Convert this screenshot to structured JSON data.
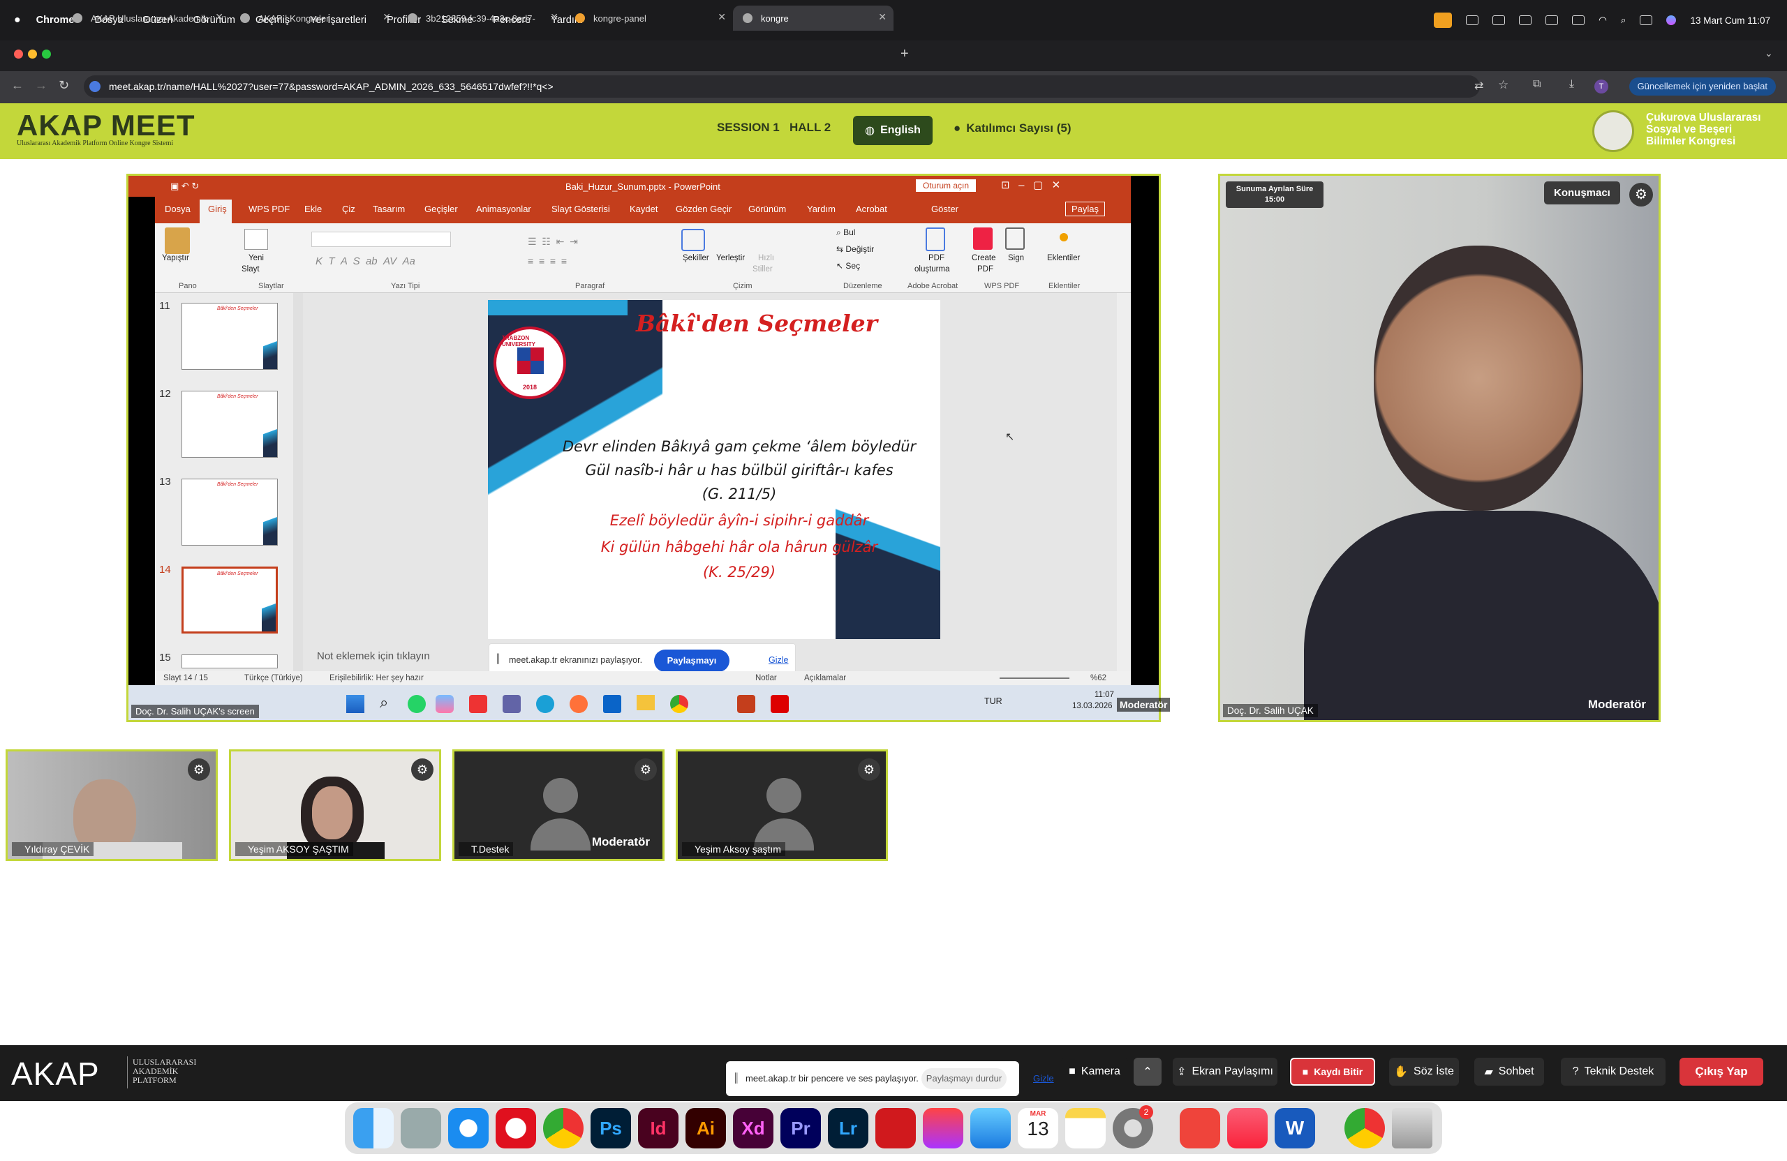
{
  "menubar": {
    "items": [
      "Chrome",
      "Dosya",
      "Düzen",
      "Görünüm",
      "Geçmiş",
      "Yer İşaretleri",
      "Profiller",
      "Sekme",
      "Pencere",
      "Yardım"
    ],
    "clock": "13 Mart Cum  11:07"
  },
  "tabs": [
    {
      "label": "AKAP Uluslararası Akademik"
    },
    {
      "label": "AKAP | Kongreler"
    },
    {
      "label": "3b212859-fc39-4a3c-8ed7-"
    },
    {
      "label": "kongre-panel"
    },
    {
      "label": "kongre"
    }
  ],
  "address": {
    "url": "meet.akap.tr/name/HALL%2027?user=77&password=AKAP_ADMIN_2026_633_5646517dwfef?!!*q<>",
    "restart_label": "Güncellemek için yeniden başlat",
    "profile_initial": "T"
  },
  "header": {
    "logo": "AKAP MEET",
    "logo_sub": "Uluslararası Akademik Platform Online Kongre Sistemi",
    "session": "SESSION 1",
    "hall": "HALL 2",
    "language": "English",
    "participants": "Katılımcı Sayısı (5)",
    "congress_l1": "Çukurova Uluslararası",
    "congress_l2": "Sosyal ve Beşeri",
    "congress_l3": "Bilimler Kongresi"
  },
  "powerpoint": {
    "title": "Baki_Huzur_Sunum.pptx  -  PowerPoint",
    "signin": "Oturum açın",
    "tabs": [
      "Dosya",
      "Giriş",
      "WPS PDF",
      "Ekle",
      "Çiz",
      "Tasarım",
      "Geçişler",
      "Animasyonlar",
      "Slayt Gösterisi",
      "Kaydet",
      "Gözden Geçir",
      "Görünüm",
      "Yardım",
      "Acrobat",
      "Göster"
    ],
    "share": "Paylaş",
    "groups": [
      "Pano",
      "Slaytlar",
      "Yazı Tipi",
      "Paragraf",
      "Çizim",
      "Düzenleme",
      "Adobe Acrobat",
      "WPS PDF",
      "Eklentiler"
    ],
    "buttons": {
      "paste": "Yapıştır",
      "new_slide_1": "Yeni",
      "new_slide_2": "Slayt",
      "shapes": "Şekiller",
      "arrange": "Yerleştir",
      "quick": "Hızlı",
      "styles": "Stiller",
      "find": "Bul",
      "replace": "Değiştir",
      "select": "Seç",
      "pdf1": "PDF",
      "pdf2": "oluşturma",
      "create1": "Create",
      "create2": "PDF",
      "sign": "Sign",
      "addins": "Eklentiler"
    },
    "thumb_numbers": [
      "11",
      "12",
      "13",
      "14",
      "15"
    ],
    "thumb_title": "Bâkî'den Seçmeler",
    "notes_placeholder": "Not eklemek için tıklayın",
    "status_slide": "Slayt 14 / 15",
    "status_lang": "Türkçe (Türkiye)",
    "status_access": "Erişilebilirlik: Her şey hazır",
    "status_notes": "Notlar",
    "status_comments": "Açıklamalar",
    "zoom": "%62",
    "share_notice": "meet.akap.tr ekranınızı paylaşıyor.",
    "stop_share": "Paylaşmayı durdur",
    "hide": "Gizle"
  },
  "slide": {
    "title": "Bâkî'den Seçmeler",
    "badge_text": "TRABZON UNIVERSITY",
    "badge_year": "2018",
    "lines": [
      {
        "text": "Devr elinden Bâkıyâ gam çekme ‘âlem böyledür",
        "color": "#1a1a1a"
      },
      {
        "text": "Gül nasîb-i hâr u has bülbül giriftâr-ı kafes",
        "color": "#1a1a1a"
      },
      {
        "text": "(G. 211/5)",
        "color": "#1a1a1a"
      },
      {
        "text": "Ezelî böyledür âyîn-i sipihr-i gaddâr",
        "color": "#d42020"
      },
      {
        "text": "Ki gülün hâbgehi hâr ola hârun gülzâr",
        "color": "#d42020"
      },
      {
        "text": "(K. 25/29)",
        "color": "#d42020"
      }
    ]
  },
  "windows_taskbar": {
    "lang": "TUR",
    "time": "11:07",
    "date": "13.03.2026"
  },
  "share_owner": "Doç. Dr. Salih UÇAK's screen",
  "share_role": "Moderatör",
  "speaker": {
    "timer_label": "Sunuma Ayrılan Süre",
    "timer_value": "15:00",
    "role_badge": "Konuşmacı",
    "name": "Doç. Dr. Salih UÇAK",
    "role": "Moderatör"
  },
  "participants": [
    {
      "name": "Yıldıray ÇEVİK",
      "role": ""
    },
    {
      "name": "Yeşim AKSOY ŞAŞTIM",
      "role": ""
    },
    {
      "name": "T.Destek",
      "role": "Moderatör"
    },
    {
      "name": "Yeşim Aksoy şaştım",
      "role": ""
    }
  ],
  "bottombar": {
    "logo": "AKAP",
    "sub_l1": "ULUSLARARASI",
    "sub_l2": "AKADEMİK",
    "sub_l3": "PLATFORM",
    "share_notice": "meet.akap.tr bir pencere ve ses paylaşıyor.",
    "stop_share": "Paylaşmayı durdur",
    "hide": "Gizle",
    "camera": "Kamera",
    "screen_share": "Ekran Paylaşımı",
    "stop_record": "Kaydı Bitir",
    "raise_hand": "Söz İste",
    "chat": "Sohbet",
    "support": "Teknik Destek",
    "exit": "Çıkış Yap"
  },
  "dock": {
    "apps": [
      "finder-icon",
      "launchpad-icon",
      "safari-icon",
      "opera-icon",
      "chrome-icon",
      "photoshop-icon",
      "indesign-icon",
      "illustrator-icon",
      "xd-icon",
      "premiere-icon",
      "lightroom-icon",
      "acrobat-icon",
      "creative-cloud-icon",
      "mail-icon",
      "calendar-icon",
      "notes-icon",
      "settings-icon",
      "anydesk-icon",
      "music-icon",
      "word-icon",
      "chrome-web-icon",
      "trash-icon"
    ],
    "labels": {
      "ps": "Ps",
      "id": "Id",
      "ai": "Ai",
      "xd": "Xd",
      "pr": "Pr",
      "lr": "Lr",
      "word": "W"
    },
    "calendar_month": "MAR",
    "calendar_day": "13",
    "settings_badge": "2"
  },
  "colors": {
    "accent": "#c3d73a",
    "brand_dark": "#2d3a1c",
    "ppt_red": "#c43e1c",
    "exit_red": "#d9343a"
  }
}
